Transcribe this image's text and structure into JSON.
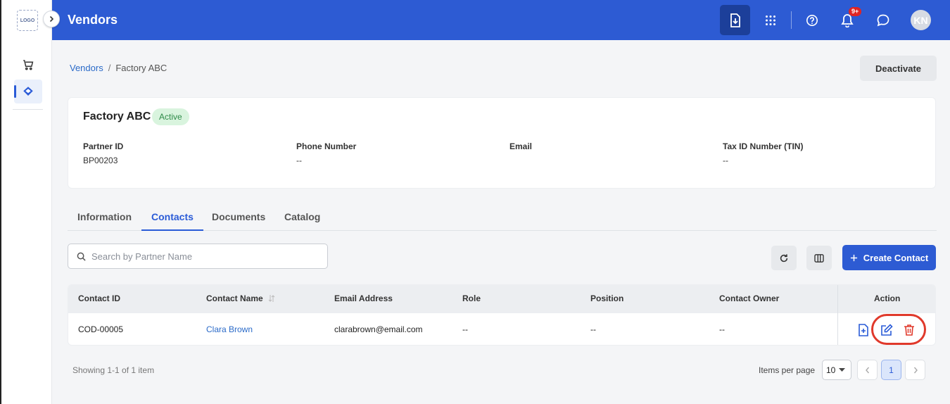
{
  "rail": {
    "logo_text": "LOGO",
    "items": [
      {
        "name": "cart",
        "icon": "cart-icon"
      },
      {
        "name": "vendors",
        "icon": "vendor-tag-icon"
      }
    ]
  },
  "header": {
    "title": "Vendors",
    "notification_badge": "9+",
    "avatar_initials": "KN",
    "brand_color": "#2d5bd3"
  },
  "breadcrumb": {
    "root": "Vendors",
    "separator": "/",
    "current": "Factory ABC"
  },
  "actions": {
    "deactivate_label": "Deactivate"
  },
  "vendor": {
    "name": "Factory ABC",
    "status": "Active",
    "fields": [
      {
        "label": "Partner ID",
        "value": "BP00203"
      },
      {
        "label": "Phone Number",
        "value": "--"
      },
      {
        "label": "Email",
        "value": ""
      },
      {
        "label": "Tax ID Number (TIN)",
        "value": "--"
      }
    ]
  },
  "tabs": [
    {
      "label": "Information",
      "active": false
    },
    {
      "label": "Contacts",
      "active": true
    },
    {
      "label": "Documents",
      "active": false
    },
    {
      "label": "Catalog",
      "active": false
    }
  ],
  "toolbar": {
    "search_placeholder": "Search by Partner Name",
    "create_label": "Create Contact"
  },
  "table": {
    "columns": [
      "Contact ID",
      "Contact Name",
      "Email Address",
      "Role",
      "Position",
      "Contact Owner",
      "Action"
    ],
    "rows": [
      {
        "contact_id": "COD-00005",
        "contact_name": "Clara Brown",
        "email": "clarabrown@email.com",
        "role": "--",
        "position": "--",
        "owner": "--"
      }
    ]
  },
  "footer": {
    "showing": "Showing 1-1 of 1 item",
    "items_per_page_label": "Items per page",
    "items_per_page": "10",
    "current_page": "1"
  }
}
